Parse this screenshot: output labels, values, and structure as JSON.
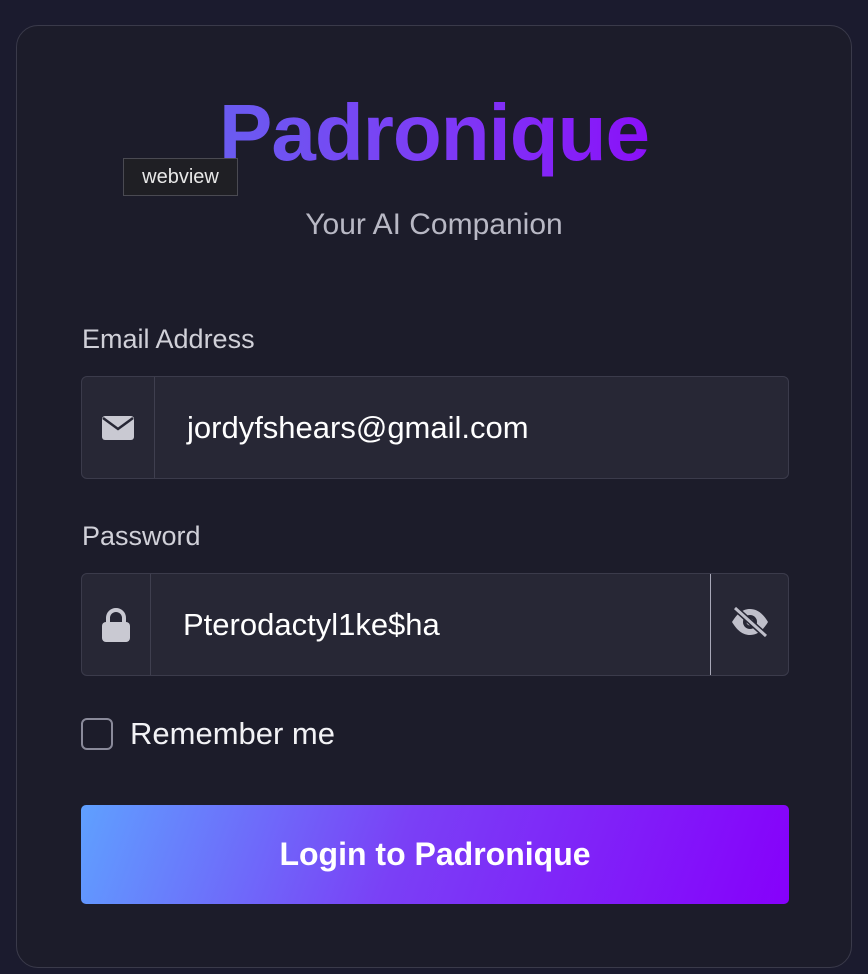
{
  "app": {
    "brand": "Padronique",
    "tagline": "Your AI Companion",
    "tooltip": "webview"
  },
  "form": {
    "email_label": "Email Address",
    "email_value": "jordyfshears@gmail.com",
    "email_icon": "envelope-icon",
    "password_label": "Password",
    "password_value": "Pterodactyl1ke$ha",
    "password_icon": "lock-icon",
    "visibility_icon": "eye-slash-icon",
    "remember_label": "Remember me",
    "remember_checked": false,
    "submit_label": "Login to Padronique"
  },
  "colors": {
    "background": "#1c1c2a",
    "accent_start": "#5fa0ff",
    "accent_end": "#8600fb"
  }
}
